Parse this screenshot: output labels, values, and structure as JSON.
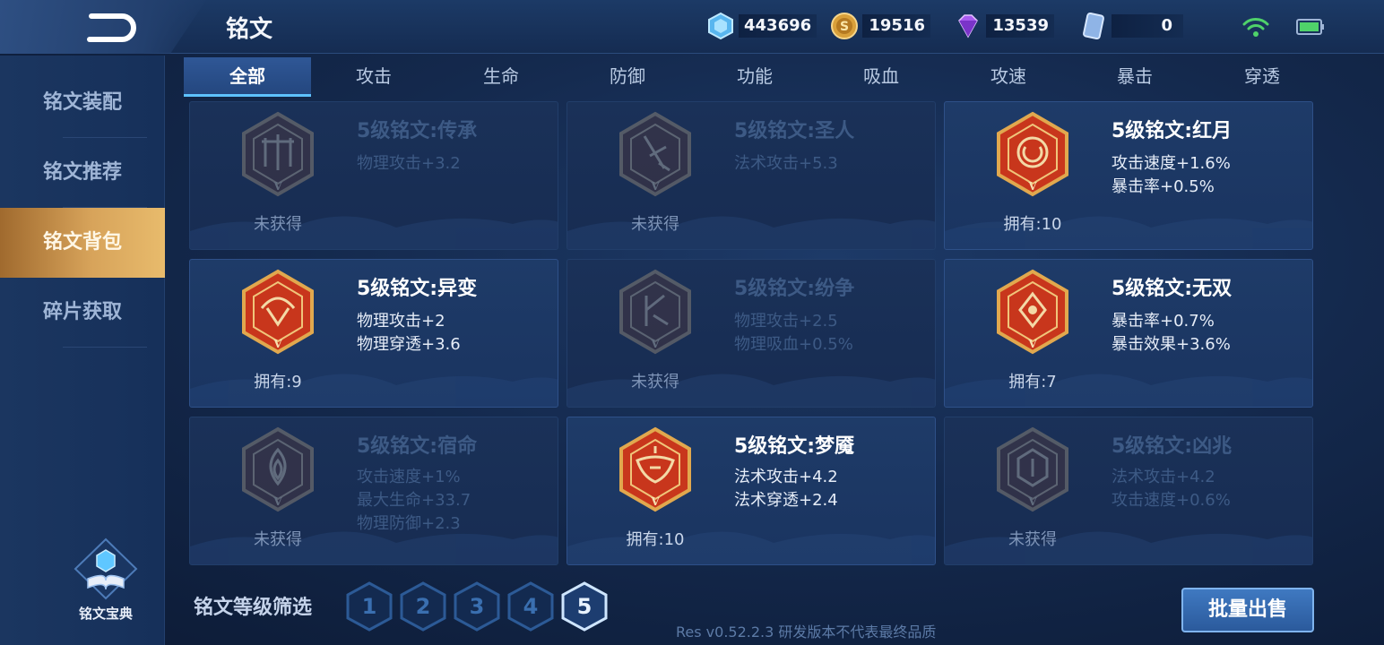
{
  "header": {
    "title": "铭文",
    "resources": {
      "crystal": "443696",
      "gold": "19516",
      "diamond": "13539",
      "card": "0"
    }
  },
  "sidebar": {
    "items": [
      {
        "label": "铭文装配"
      },
      {
        "label": "铭文推荐"
      },
      {
        "label": "铭文背包"
      },
      {
        "label": "碎片获取"
      }
    ],
    "active_index": 2,
    "codex_label": "铭文宝典"
  },
  "tabs": [
    {
      "label": "全部"
    },
    {
      "label": "攻击"
    },
    {
      "label": "生命"
    },
    {
      "label": "防御"
    },
    {
      "label": "功能"
    },
    {
      "label": "吸血"
    },
    {
      "label": "攻速"
    },
    {
      "label": "暴击"
    },
    {
      "label": "穿透"
    }
  ],
  "active_tab": 0,
  "cards": [
    {
      "name": "5级铭文:传承",
      "attrs": [
        "物理攻击+3.2"
      ],
      "owned": "未获得",
      "locked": true,
      "color": "#8a2e22"
    },
    {
      "name": "5级铭文:圣人",
      "attrs": [
        "法术攻击+5.3"
      ],
      "owned": "未获得",
      "locked": true,
      "color": "#8a2e22"
    },
    {
      "name": "5级铭文:红月",
      "attrs": [
        "攻击速度+1.6%",
        "暴击率+0.5%"
      ],
      "owned": "拥有:10",
      "locked": false,
      "color": "#c8361c"
    },
    {
      "name": "5级铭文:异变",
      "attrs": [
        "物理攻击+2",
        "物理穿透+3.6"
      ],
      "owned": "拥有:9",
      "locked": false,
      "color": "#c8361c"
    },
    {
      "name": "5级铭文:纷争",
      "attrs": [
        "物理攻击+2.5",
        "物理吸血+0.5%"
      ],
      "owned": "未获得",
      "locked": true,
      "color": "#8a2e22"
    },
    {
      "name": "5级铭文:无双",
      "attrs": [
        "暴击率+0.7%",
        "暴击效果+3.6%"
      ],
      "owned": "拥有:7",
      "locked": false,
      "color": "#c8361c"
    },
    {
      "name": "5级铭文:宿命",
      "attrs": [
        "攻击速度+1%",
        "最大生命+33.7",
        "物理防御+2.3"
      ],
      "owned": "未获得",
      "locked": true,
      "color": "#8a2e22"
    },
    {
      "name": "5级铭文:梦魇",
      "attrs": [
        "法术攻击+4.2",
        "法术穿透+2.4"
      ],
      "owned": "拥有:10",
      "locked": false,
      "color": "#c8361c"
    },
    {
      "name": "5级铭文:凶兆",
      "attrs": [
        "法术攻击+4.2",
        "攻击速度+0.6%"
      ],
      "owned": "未获得",
      "locked": true,
      "color": "#8a2e22"
    }
  ],
  "footer": {
    "filter_label": "铭文等级筛选",
    "levels": [
      "1",
      "2",
      "3",
      "4",
      "5"
    ],
    "active_level": "5",
    "sell_label": "批量出售",
    "version": "Res v0.52.2.3 研发版本不代表最终品质"
  },
  "gem_level_mark": "V"
}
